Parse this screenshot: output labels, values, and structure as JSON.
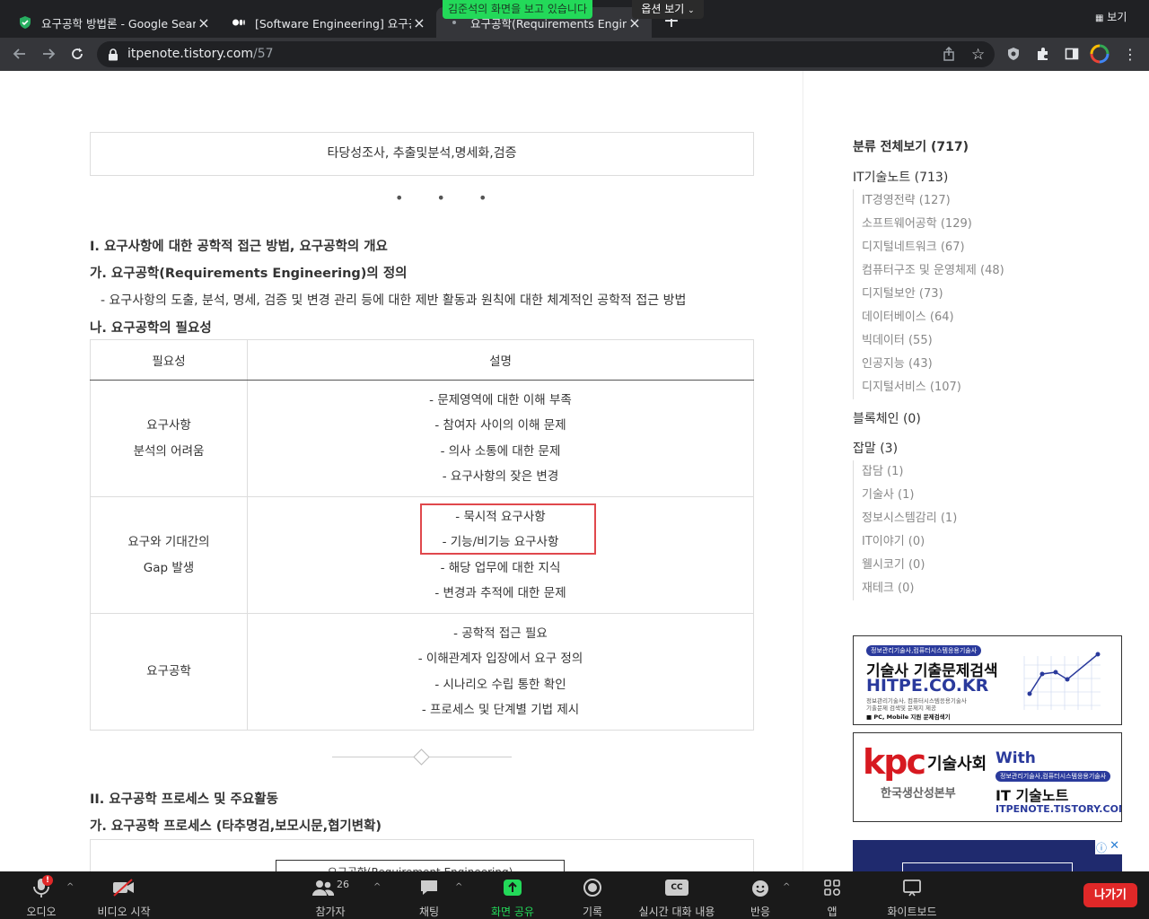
{
  "browser": {
    "tabs": [
      {
        "title": "요구공학 방법론 - Google Search",
        "active": false
      },
      {
        "title": "[Software Engineering] 요구공학",
        "active": false
      },
      {
        "title": "요구공학(Requirements Enginee",
        "active": true
      }
    ],
    "url_host": "itpenote.tistory.com",
    "url_path": "/57",
    "view_label": "보기"
  },
  "zoom_overlay": {
    "sharing_banner": "김준석의 화면을 보고 있습니다",
    "options_label": "옵션 보기"
  },
  "article": {
    "summary_box": "타당성조사, 추출및분석,명세화,검증",
    "dots": "• • •",
    "h1": "I. 요구사항에 대한 공학적 접근 방법, 요구공학의 개요",
    "h1a": "가. 요구공학(Requirements Engineering)의 정의",
    "def_text": "- 요구사항의 도출, 분석, 명세, 검증 및 변경 관리 등에 대한 제반 활동과 원칙에 대한 체계적인 공학적 접근 방법",
    "h1b": "나. 요구공학의 필요성",
    "table": {
      "headers": [
        "필요성",
        "설명"
      ],
      "rows": [
        {
          "need": [
            "요구사항",
            "분석의 어려움"
          ],
          "desc": [
            "- 문제영역에 대한 이해 부족",
            "- 참여자 사이의 이해 문제",
            "- 의사 소통에 대한 문제",
            "- 요구사항의 잦은 변경"
          ]
        },
        {
          "need": [
            "요구와 기대간의",
            "Gap 발생"
          ],
          "desc": [
            "- 묵시적 요구사항",
            "- 기능/비기능 요구사항",
            "- 해당 업무에 대한 지식",
            "- 변경과 추적에 대한 문제"
          ]
        },
        {
          "need": [
            "요구공학"
          ],
          "desc": [
            "- 공학적 접근 필요",
            "- 이해관계자 입장에서 요구 정의",
            "- 시나리오 수립 통한 확인",
            "- 프로세스 및 단계별 기법 제시"
          ]
        }
      ]
    },
    "h2": "II. 요구공학 프로세스 및 주요활동",
    "h2a": "가. 요구공학 프로세스 (타추명검,보모시문,협기변확)",
    "diagram_title": "요구공학(Requirement Engineering)"
  },
  "sidebar": {
    "all": "분류 전체보기 (717)",
    "it": "IT기술노트 (713)",
    "it_items": [
      "IT경영전략 (127)",
      "소프트웨어공학 (129)",
      "디지털네트워크 (67)",
      "컴퓨터구조 및 운영체제 (48)",
      "디지털보안 (73)",
      "데이터베이스 (64)",
      "빅데이터 (55)",
      "인공지능 (43)",
      "디지털서비스 (107)"
    ],
    "blockchain": "블록체인 (0)",
    "misc": "잡말 (3)",
    "misc_items": [
      "잡담 (1)",
      "기술사 (1)",
      "정보시스템감리 (1)",
      "IT이야기 (0)",
      "웰시코기 (0)",
      "재테크 (0)"
    ],
    "ad1": {
      "tag": "정보관리기술사,컴퓨터시스템응용기술사",
      "title": "기술사 기출문제검색",
      "site": "HITPE.CO.KR",
      "desc1": "정보관리기술사, 컴퓨터시스템응용기술사",
      "desc2": "기출문제 검색및 문제지 제공",
      "foot": "■ PC, Mobile 지원 문제검색기"
    },
    "ad2": {
      "logo": "kpc",
      "org": "기술사회",
      "org_sub": "한국생산성본부",
      "with": "With",
      "tag": "정보관리기술사,컴퓨터시스템응용기술사",
      "brand": "IT 기술노트",
      "url": "ITPENOTE.TISTORY.COM"
    }
  },
  "zoom_bar": {
    "audio": "오디오",
    "video": "비디오 시작",
    "participants": "참가자",
    "participants_count": "26",
    "chat": "채팅",
    "share": "화면 공유",
    "record": "기록",
    "captions": "실시간 대화 내용",
    "cc": "CC",
    "reactions": "반응",
    "apps": "앱",
    "whiteboard": "화이트보드",
    "leave": "나가기",
    "audio_badge": "!"
  },
  "colors": {
    "share_green": "#23d959",
    "leave_red": "#e02828",
    "highlight_box": "#e0484c"
  }
}
